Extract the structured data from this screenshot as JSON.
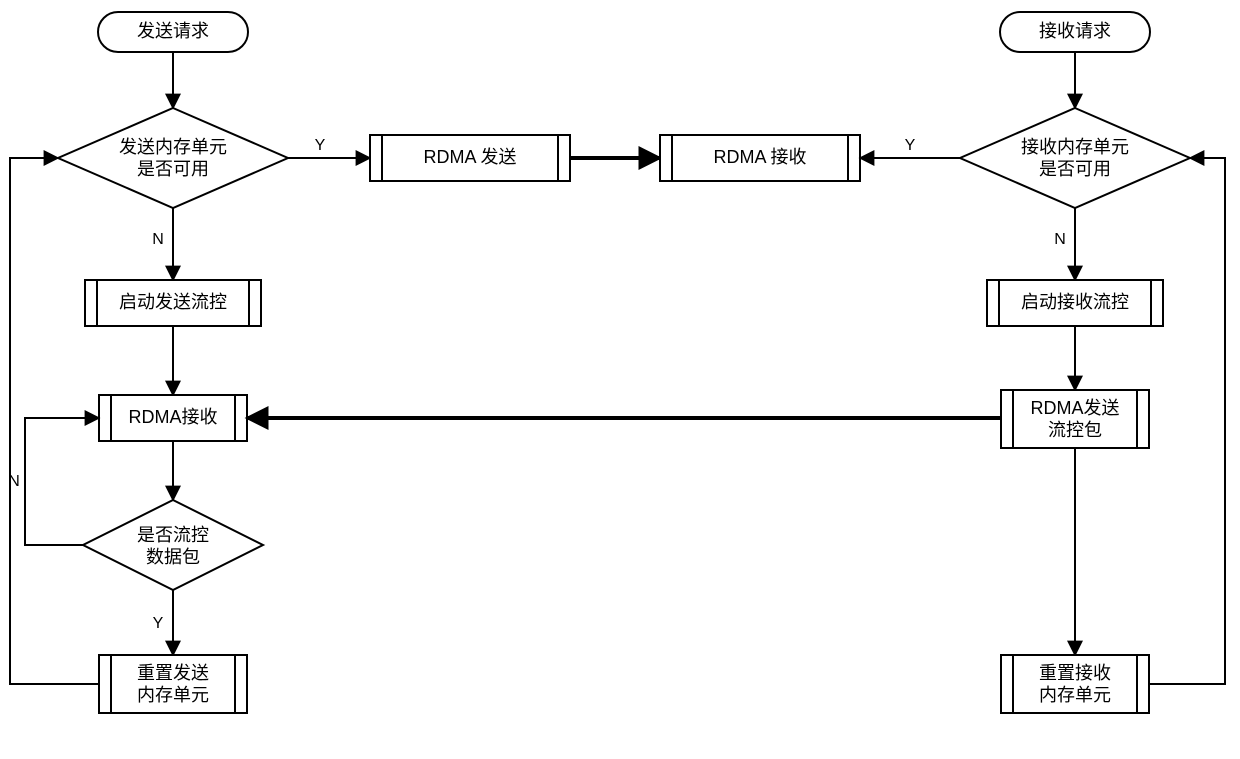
{
  "nodes": {
    "send_request": {
      "label": "发送请求"
    },
    "recv_request": {
      "label": "接收请求"
    },
    "send_mem_avail": {
      "line1": "发送内存单元",
      "line2": "是否可用"
    },
    "recv_mem_avail": {
      "line1": "接收内存单元",
      "line2": "是否可用"
    },
    "rdma_send": {
      "label": "RDMA 发送"
    },
    "rdma_recv": {
      "label": "RDMA 接收"
    },
    "start_send_flow": {
      "label": "启动发送流控"
    },
    "start_recv_flow": {
      "label": "启动接收流控"
    },
    "rdma_recv2": {
      "label": "RDMA接收"
    },
    "rdma_send_flow": {
      "line1": "RDMA发送",
      "line2": "流控包"
    },
    "is_flow_pkt": {
      "line1": "是否流控",
      "line2": "数据包"
    },
    "reset_send_mem": {
      "line1": "重置发送",
      "line2": "内存单元"
    },
    "reset_recv_mem": {
      "line1": "重置接收",
      "line2": "内存单元"
    }
  },
  "labels": {
    "yes": "Y",
    "no": "N"
  }
}
